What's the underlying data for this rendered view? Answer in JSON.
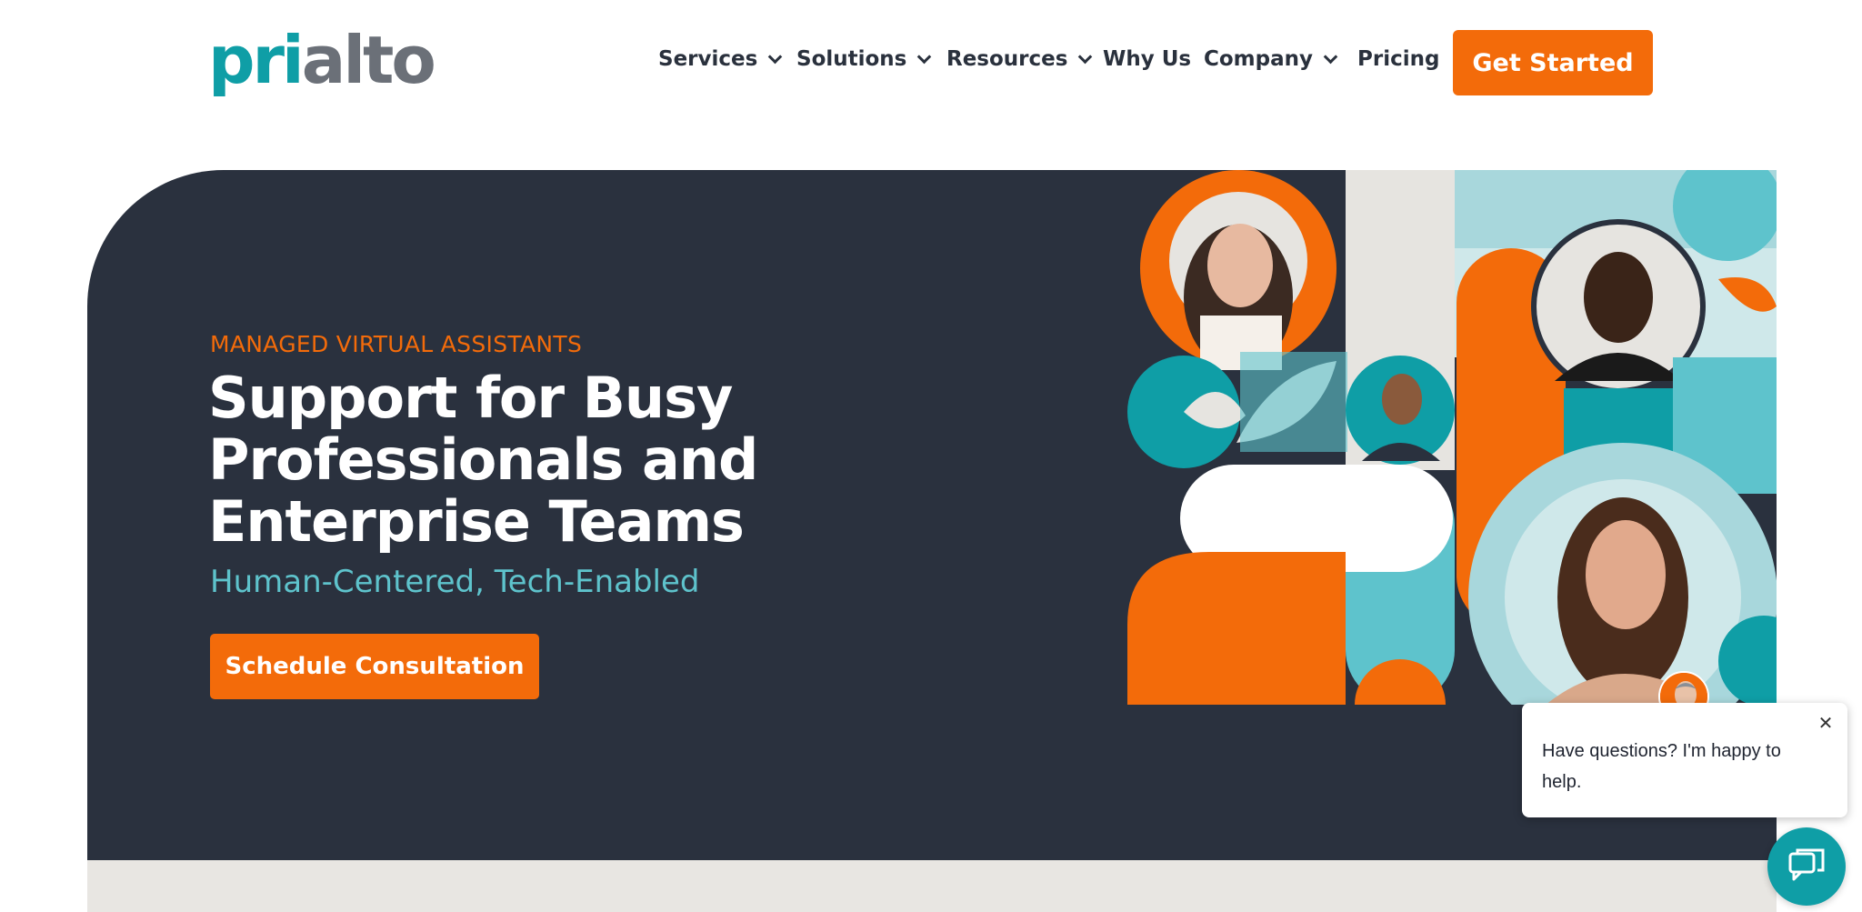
{
  "logo": {
    "part1": "pri",
    "part2": "alto"
  },
  "nav": {
    "items": [
      {
        "label": "Services",
        "has_dropdown": true
      },
      {
        "label": "Solutions",
        "has_dropdown": true
      },
      {
        "label": "Resources",
        "has_dropdown": true
      },
      {
        "label": "Why Us",
        "has_dropdown": false
      },
      {
        "label": "Company",
        "has_dropdown": true
      },
      {
        "label": "Pricing",
        "has_dropdown": false
      }
    ],
    "cta_label": "Get Started"
  },
  "hero": {
    "eyebrow": "MANAGED VIRTUAL ASSISTANTS",
    "headline_line1": "Support for Busy",
    "headline_line2": "Professionals and",
    "headline_line3": "Enterprise Teams",
    "subhead": "Human-Centered, Tech-Enabled",
    "cta_label": "Schedule Consultation"
  },
  "chat": {
    "message": "Have questions? I'm happy to help.",
    "close_icon": "close-icon",
    "launcher_icon": "chat-icon"
  },
  "colors": {
    "accent_orange": "#f36b0a",
    "brand_teal": "#0f9ea6",
    "hero_bg": "#2a313e",
    "subhead_teal": "#5ec3cc"
  }
}
